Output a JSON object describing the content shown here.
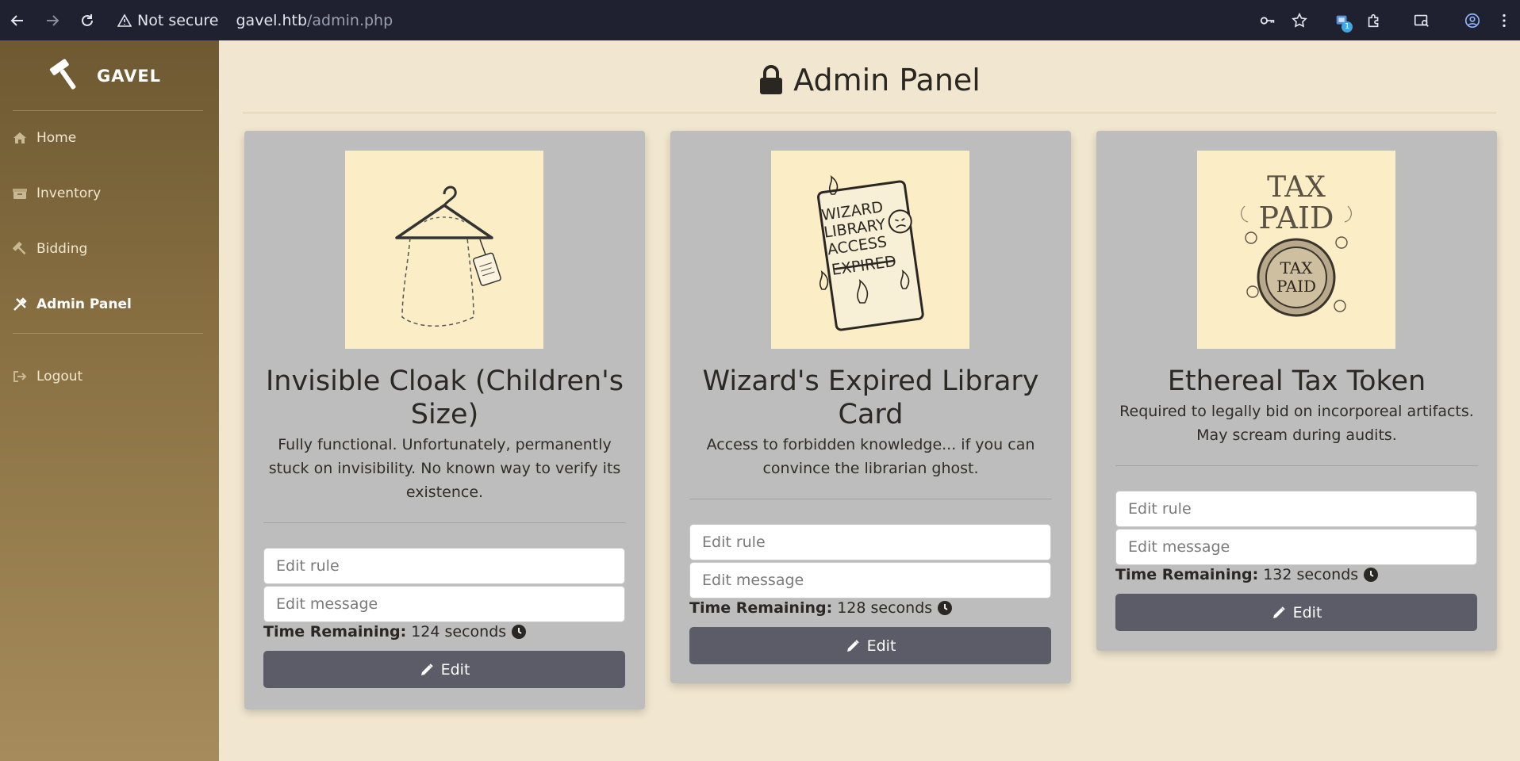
{
  "browser": {
    "security_label": "Not secure",
    "url_host": "gavel.htb",
    "url_path": "/admin.php",
    "extension_badge": "1"
  },
  "sidebar": {
    "brand": "GAVEL",
    "items": [
      {
        "label": "Home",
        "icon": "home-icon"
      },
      {
        "label": "Inventory",
        "icon": "box-icon"
      },
      {
        "label": "Bidding",
        "icon": "hammer-icon"
      },
      {
        "label": "Admin Panel",
        "icon": "tools-icon",
        "active": true
      },
      {
        "label": "Logout",
        "icon": "logout-icon"
      }
    ]
  },
  "page": {
    "title": "Admin Panel"
  },
  "cards": [
    {
      "name": "Invisible Cloak (Children's Size)",
      "description": "Fully functional. Unfortunately, permanently stuck on invisibility. No known way to verify its existence.",
      "rule_placeholder": "Edit rule",
      "message_placeholder": "Edit message",
      "time_label": "Time Remaining:",
      "time_value": "124 seconds",
      "button_label": "Edit",
      "image": "hanger-illustration"
    },
    {
      "name": "Wizard's Expired Library Card",
      "description": "Access to forbidden knowledge... if you can convince the librarian ghost.",
      "rule_placeholder": "Edit rule",
      "message_placeholder": "Edit message",
      "time_label": "Time Remaining:",
      "time_value": "128 seconds",
      "button_label": "Edit",
      "image": "library-card-illustration",
      "image_text": [
        "WIZARD",
        "LIBRARY",
        "ACCESS",
        "EXPIRED"
      ]
    },
    {
      "name": "Ethereal Tax Token",
      "description": "Required to legally bid on incorporeal artifacts. May scream during audits.",
      "rule_placeholder": "Edit rule",
      "message_placeholder": "Edit message",
      "time_label": "Time Remaining:",
      "time_value": "132 seconds",
      "button_label": "Edit",
      "image": "tax-token-illustration",
      "image_text": [
        "TAX",
        "PAID",
        "TAX",
        "PAID"
      ]
    }
  ]
}
